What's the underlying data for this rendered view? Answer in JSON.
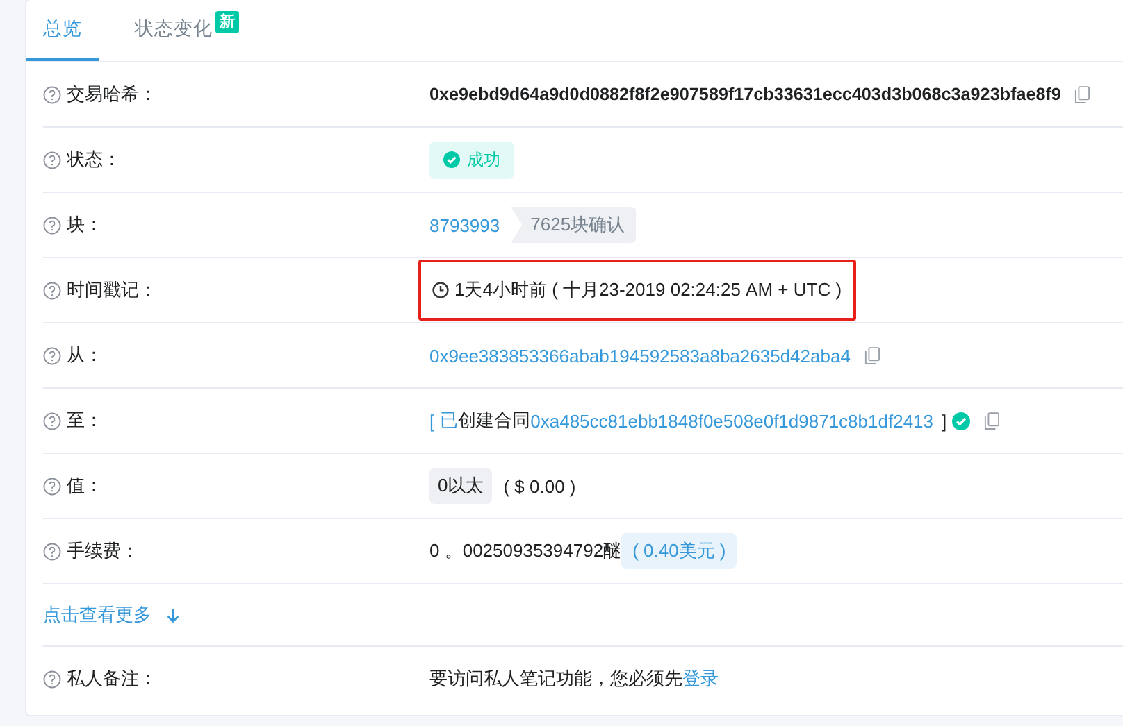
{
  "tabs": [
    {
      "label": "总览",
      "selected": true
    },
    {
      "label": "状态变化",
      "selected": false,
      "badge": "新"
    }
  ],
  "rows": [
    {
      "kind": "hash",
      "label": "交易哈希：",
      "value": "0xe9ebd9d64a9d0d0882f8f2e907589f17cb33631ecc403d3b068c3a923bfae8f9"
    },
    {
      "kind": "status",
      "label": "状态：",
      "value": "成功"
    },
    {
      "kind": "block",
      "label": "块：",
      "value": "8793993",
      "tag": "7625块确认"
    },
    {
      "kind": "time",
      "label": "时间戳记：",
      "value": "1天4小时前 ( 十月23-2019 02:24:25 AM + UTC )",
      "highlighted": true
    },
    {
      "kind": "address",
      "label": "从：",
      "value": "0x9ee383853366abab194592583a8ba2635d42aba4"
    },
    {
      "kind": "contract",
      "label": "至：",
      "prefix": "[",
      "status_word": "已",
      "text": "创建合同",
      "value": "0xa485cc81ebb1848f0e508e0f1d9871c8b1df2413",
      "suffix": "]",
      "verified": true
    },
    {
      "kind": "value",
      "label": "值：",
      "tag": "0以太",
      "value": "( $ 0.00 )"
    },
    {
      "kind": "fee",
      "label": "手续费：",
      "value": "0 。00250935394792醚",
      "tag": "( 0.40美元 )"
    }
  ],
  "more_link": "点击查看更多",
  "note": {
    "label": "私人备注：",
    "text": "要访问私人笔记功能，您必须先",
    "link": "登录"
  }
}
